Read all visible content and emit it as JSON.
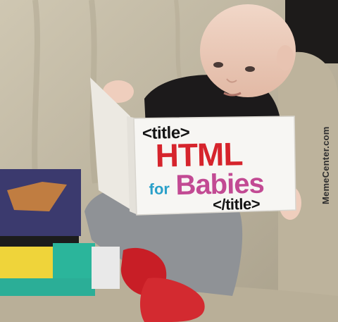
{
  "book": {
    "tag_open": "<title>",
    "title": "HTML",
    "for_word": "for",
    "babies_word": "Babies",
    "tag_close": "</title>"
  },
  "watermark": "MemeCenter.com",
  "colors": {
    "title_red": "#d6242c",
    "for_blue": "#2aa0c9",
    "babies_pink": "#c24a93",
    "tag_black": "#141414"
  }
}
